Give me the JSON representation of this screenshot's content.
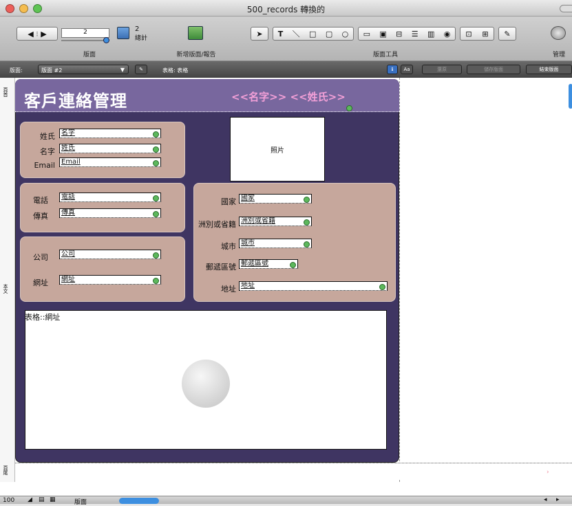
{
  "window": {
    "title": "500_records 轉換的"
  },
  "toolbar": {
    "record_number": "2",
    "record_total": "2",
    "record_total_label": "總計",
    "layout_label": "版面",
    "new_layout_label": "新增版面/報告",
    "layout_tools_label": "版面工具",
    "manage_label": "管理"
  },
  "layoutbar": {
    "layout_prefix": "版面:",
    "layout_select": "版面 #2",
    "table_label": "表格: 表格",
    "font_button": "Aa",
    "revert_button": "還原",
    "save_button": "儲存版面",
    "exit_button": "結束版面"
  },
  "parts": {
    "header": "頁首",
    "body": "本文",
    "footer": "頁尾"
  },
  "layout": {
    "title": "客戶連絡管理",
    "merge_name": "<<名字>> <<姓氏>>",
    "photo_label": "照片",
    "portal_label": "表格::網址",
    "name_panel": [
      {
        "label": "姓氏",
        "field": "名字"
      },
      {
        "label": "名字",
        "field": "姓氏"
      },
      {
        "label": "Email",
        "field": "Email"
      }
    ],
    "phone_panel": [
      {
        "label": "電話",
        "field": "電話"
      },
      {
        "label": "傳真",
        "field": "傳真"
      }
    ],
    "company_panel": [
      {
        "label": "公司",
        "field": "公司"
      },
      {
        "label": "網址",
        "field": "網址"
      }
    ],
    "address_panel": [
      {
        "label": "國家",
        "field": "國家"
      },
      {
        "label": "洲別或省籍",
        "field": "洲別或省籍"
      },
      {
        "label": "城市",
        "field": "城市"
      },
      {
        "label": "郵遞區號",
        "field": "郵遞區號"
      },
      {
        "label": "地址",
        "field": "地址"
      }
    ]
  },
  "status": {
    "zoom": "100",
    "mode": "版面"
  }
}
